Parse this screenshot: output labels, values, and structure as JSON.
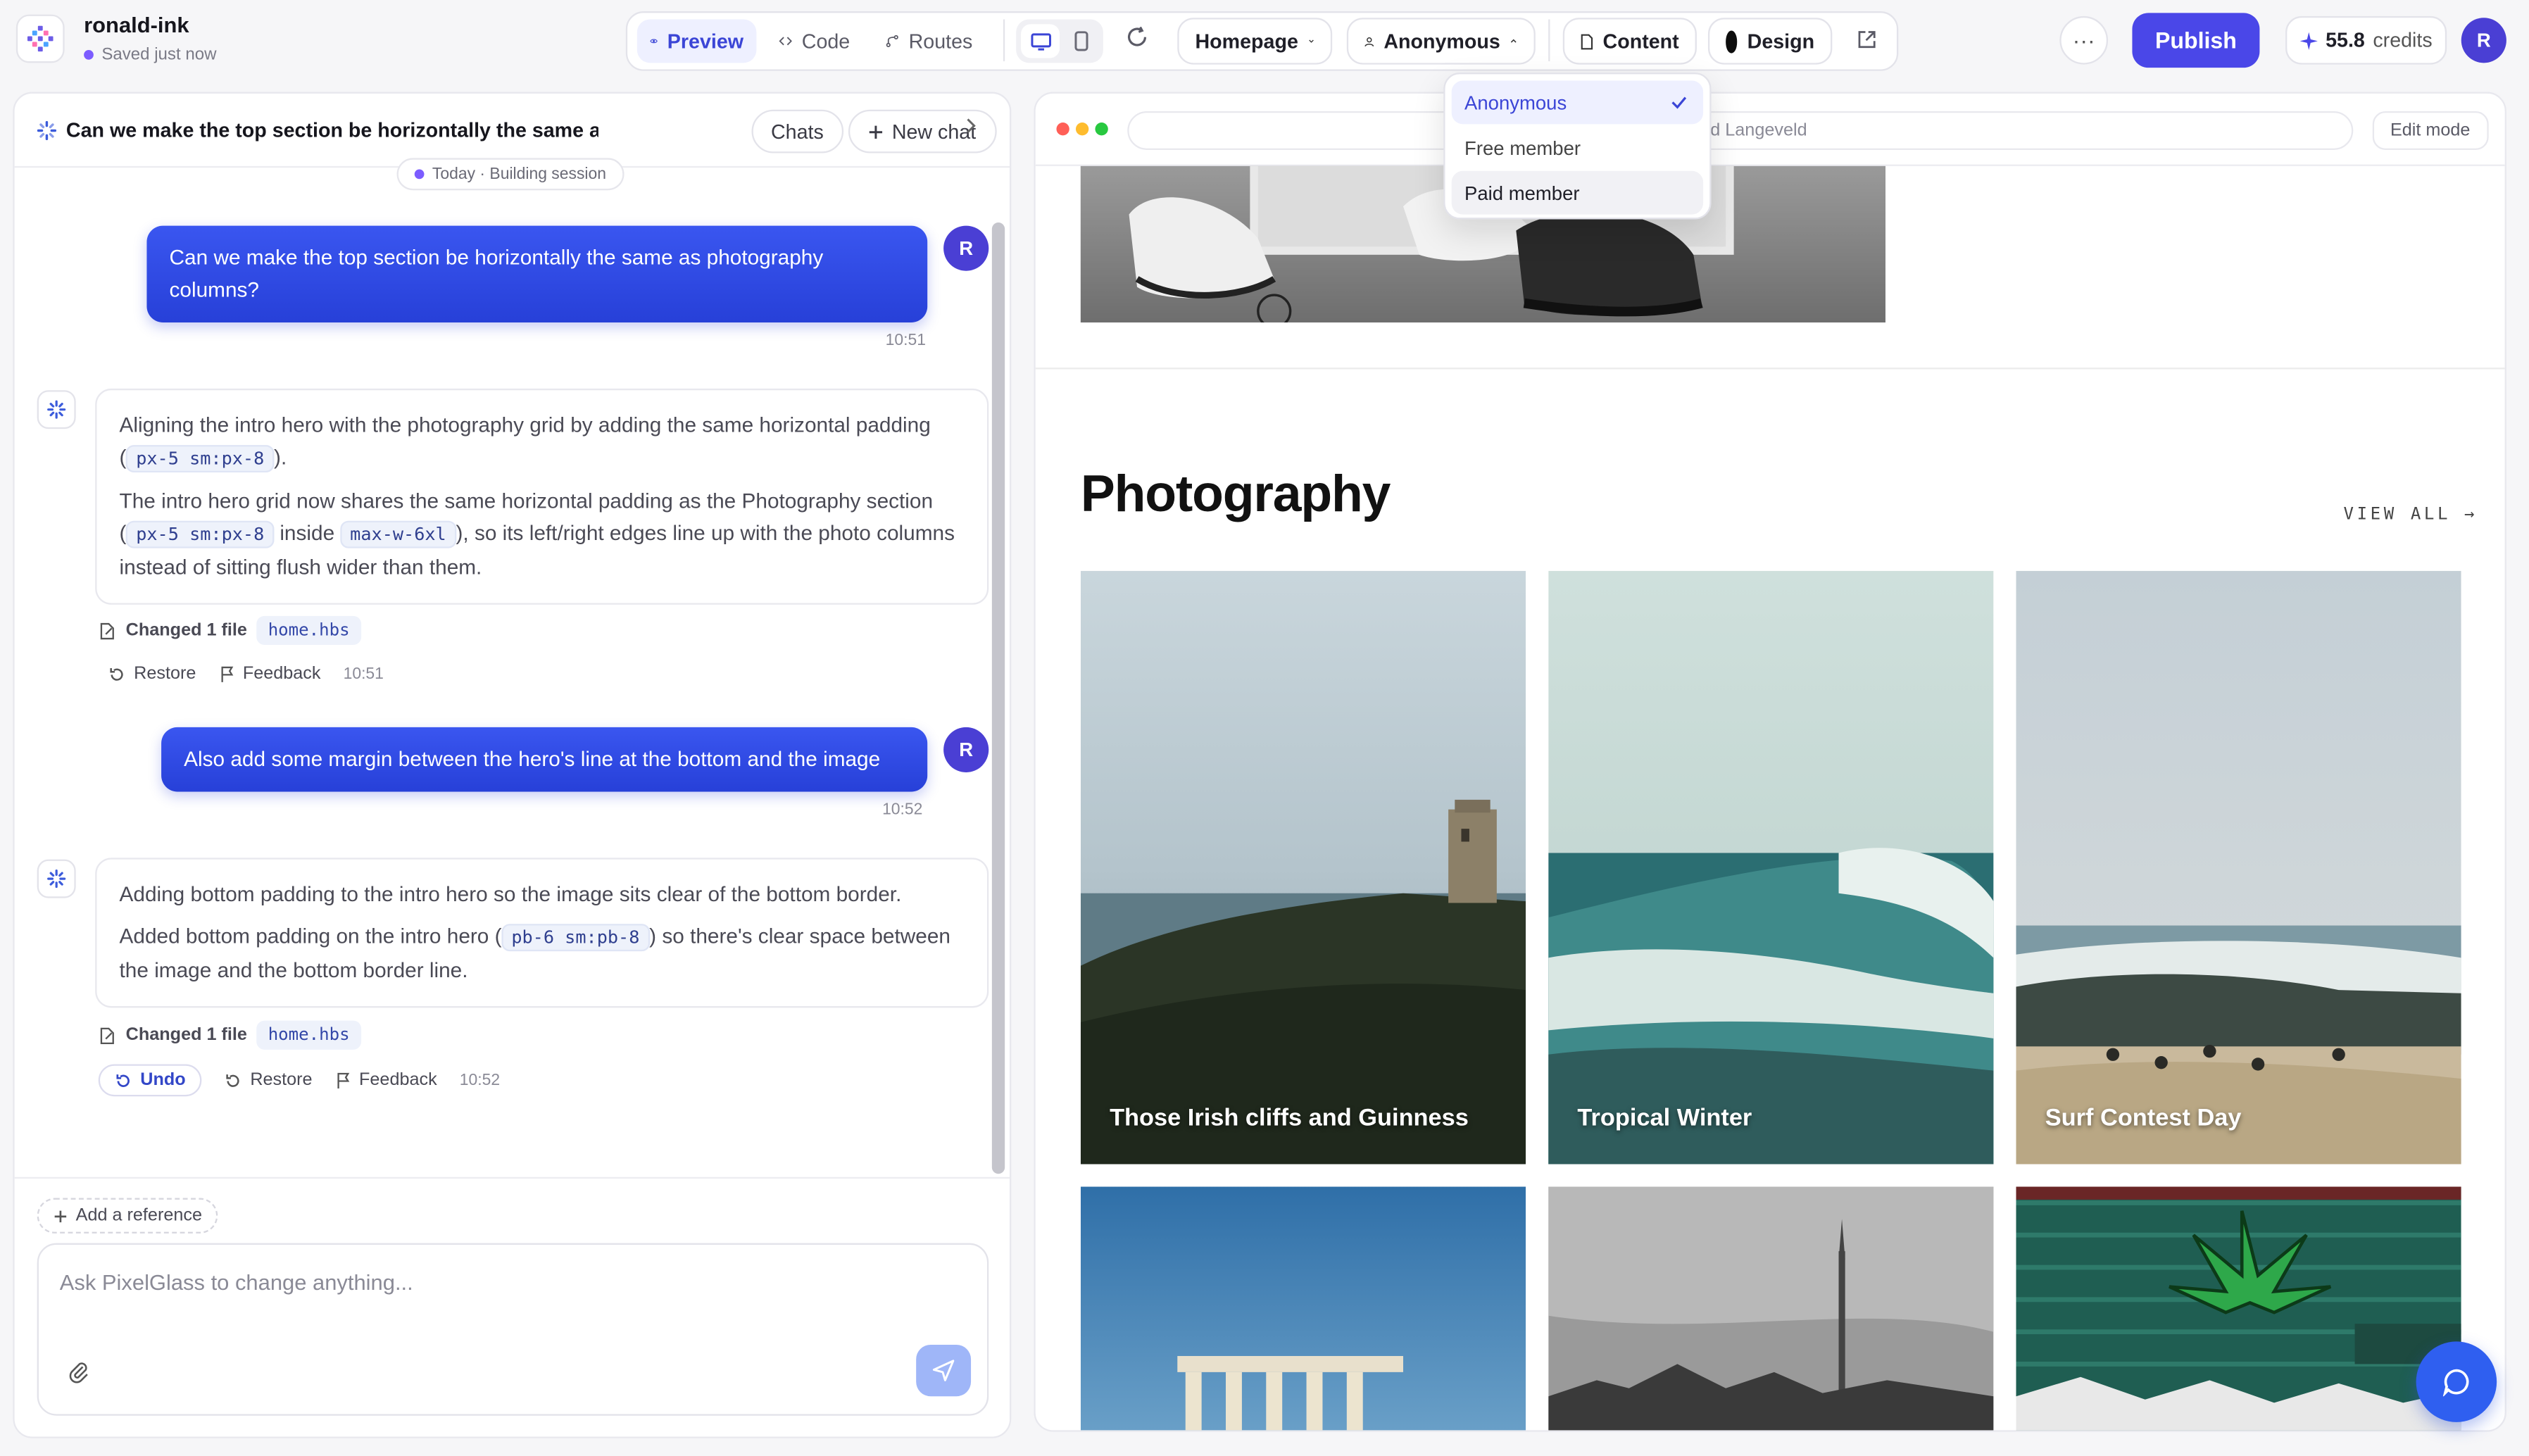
{
  "project": {
    "name": "ronald-ink",
    "status": "Saved just now"
  },
  "toolbar": {
    "preview_label": "Preview",
    "code_label": "Code",
    "routes_label": "Routes",
    "page_select": "Homepage",
    "audience_select": "Anonymous",
    "content_label": "Content",
    "design_label": "Design",
    "publish_label": "Publish",
    "credits_value": "55.8",
    "credits_label": "credits",
    "avatar_initial": "R",
    "more_label": "···"
  },
  "audience_dropdown": {
    "options": [
      "Anonymous",
      "Free member",
      "Paid member"
    ],
    "selected": "Anonymous"
  },
  "chat": {
    "title": "Can we make the top section be horizontally the same as phot",
    "chats_label": "Chats",
    "new_chat_label": "New chat",
    "session_label": "Today · Building session",
    "messages": [
      {
        "role": "user",
        "text": "Can we make the top section be horizontally the same as photography columns?",
        "time": "10:51",
        "avatar": "R"
      },
      {
        "role": "assistant",
        "p1_a": "Aligning the intro hero with the photography grid by adding the same horizontal padding (",
        "p1_code": "px-5 sm:px-8",
        "p1_b": ").",
        "p2_a": "The intro hero grid now shares the same horizontal padding as the Photography section (",
        "p2_code1": "px-5 sm:px-8",
        "p2_mid": " inside ",
        "p2_code2": "max-w-6xl",
        "p2_b": "), so its left/right edges line up with the photo columns instead of sitting flush wider than them.",
        "changed_label": "Changed 1 file",
        "file": "home.hbs",
        "restore_label": "Restore",
        "feedback_label": "Feedback",
        "time": "10:51"
      },
      {
        "role": "user",
        "text": "Also add some margin between the hero's line at the bottom and the image",
        "time": "10:52",
        "avatar": "R"
      },
      {
        "role": "assistant",
        "p1": "Adding bottom padding to the intro hero so the image sits clear of the bottom border.",
        "p2_a": "Added bottom padding on the intro hero (",
        "p2_code": "pb-6 sm:pb-8",
        "p2_b": ") so there's clear space between the image and the bottom border line.",
        "changed_label": "Changed 1 file",
        "file": "home.hbs",
        "undo_label": "Undo",
        "restore_label": "Restore",
        "feedback_label": "Feedback",
        "time": "10:52"
      }
    ],
    "add_reference_label": "Add a reference",
    "input_placeholder": "Ask PixelGlass to change anything..."
  },
  "preview": {
    "url_text": "ld Langeveld",
    "edit_mode_label": "Edit mode",
    "section_title": "Photography",
    "view_all_label": "VIEW ALL →",
    "photos": [
      {
        "caption": "Those Irish cliffs and Guinness"
      },
      {
        "caption": "Tropical Winter"
      },
      {
        "caption": "Surf Contest Day"
      },
      {
        "caption": ""
      },
      {
        "caption": ""
      },
      {
        "caption": ""
      }
    ]
  },
  "colors": {
    "accent": "#4a47e8",
    "user_bubble": "#2f4ae4",
    "selected_bg": "#eef0ff"
  }
}
